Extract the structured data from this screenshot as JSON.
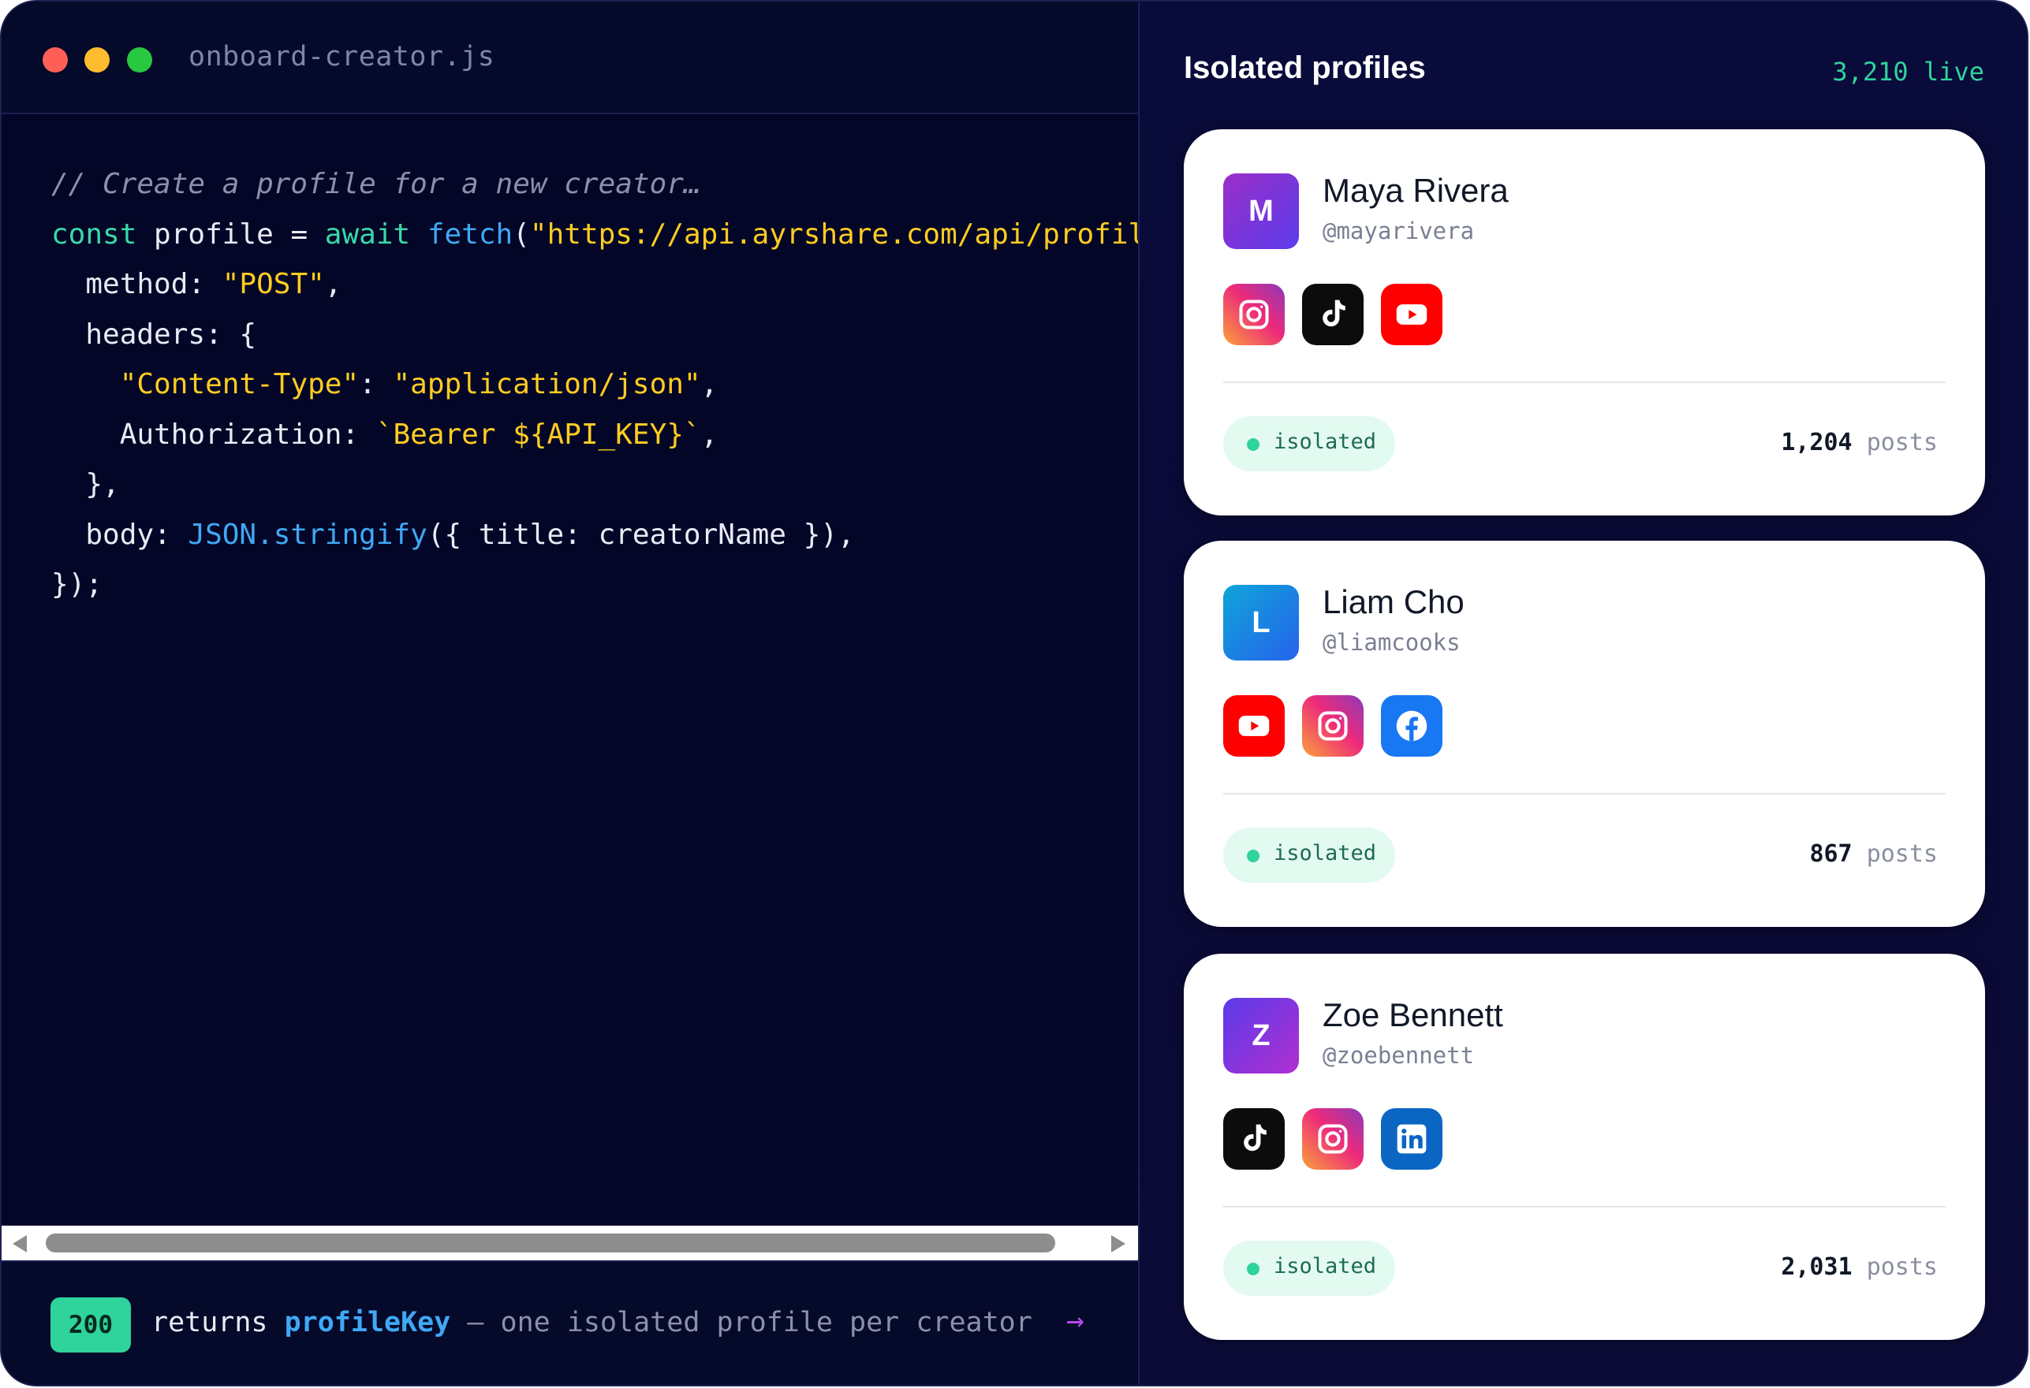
{
  "editor": {
    "filename": "onboard-creator.js",
    "code_lines": [
      [
        {
          "t": "// Create a profile for a new creator…",
          "c": "comment"
        }
      ],
      [
        {
          "t": "const",
          "c": "kw"
        },
        {
          "t": " profile = ",
          "c": "txt"
        },
        {
          "t": "await",
          "c": "kw"
        },
        {
          "t": " ",
          "c": "txt"
        },
        {
          "t": "fetch",
          "c": "fn"
        },
        {
          "t": "(",
          "c": "txt"
        },
        {
          "t": "\"https://api.ayrshare.com/api/profiles\"",
          "c": "str"
        },
        {
          "t": ", {",
          "c": "txt"
        }
      ],
      [
        {
          "t": "  method: ",
          "c": "txt"
        },
        {
          "t": "\"POST\"",
          "c": "str"
        },
        {
          "t": ",",
          "c": "txt"
        }
      ],
      [
        {
          "t": "  headers: {",
          "c": "txt"
        }
      ],
      [
        {
          "t": "    ",
          "c": "txt"
        },
        {
          "t": "\"Content-Type\"",
          "c": "str"
        },
        {
          "t": ": ",
          "c": "txt"
        },
        {
          "t": "\"application/json\"",
          "c": "str"
        },
        {
          "t": ",",
          "c": "txt"
        }
      ],
      [
        {
          "t": "    Authorization: ",
          "c": "txt"
        },
        {
          "t": "`Bearer ${API_KEY}`",
          "c": "str"
        },
        {
          "t": ",",
          "c": "txt"
        }
      ],
      [
        {
          "t": "  },",
          "c": "txt"
        }
      ],
      [
        {
          "t": "  body: ",
          "c": "txt"
        },
        {
          "t": "JSON.stringify",
          "c": "fn"
        },
        {
          "t": "({ title: creatorName }),",
          "c": "txt"
        }
      ],
      [
        {
          "t": "});",
          "c": "txt"
        }
      ]
    ],
    "scrollbar_position": 0.0
  },
  "footer": {
    "status_code": "200",
    "returns_label": "returns",
    "key_name": "profileKey",
    "description": " — one isolated profile per creator",
    "arrow_icon": "arrow-right-icon"
  },
  "panel": {
    "title": "Isolated profiles",
    "live_count": "3,210 live"
  },
  "profiles": [
    {
      "initial": "M",
      "name": "Maya Rivera",
      "handle": "@mayarivera",
      "avatar_gradient": [
        "#9b2fc9",
        "#5b3bea"
      ],
      "socials": [
        "instagram",
        "tiktok",
        "youtube"
      ],
      "status": "isolated",
      "post_count": "1,204",
      "post_unit": "posts"
    },
    {
      "initial": "L",
      "name": "Liam Cho",
      "handle": "@liamcooks",
      "avatar_gradient": [
        "#0ea5d9",
        "#2563eb"
      ],
      "socials": [
        "youtube",
        "instagram",
        "facebook"
      ],
      "status": "isolated",
      "post_count": "867",
      "post_unit": "posts"
    },
    {
      "initial": "Z",
      "name": "Zoe Bennett",
      "handle": "@zoebennett",
      "avatar_gradient": [
        "#5b3bea",
        "#b02fd0"
      ],
      "socials": [
        "tiktok",
        "instagram",
        "linkedin"
      ],
      "status": "isolated",
      "post_count": "2,031",
      "post_unit": "posts"
    }
  ],
  "colors": {
    "accent_green": "#2fd39c",
    "accent_blue": "#3fa8f5",
    "string_yellow": "#ffcc22",
    "arrow_purple": "#b54ae8"
  }
}
